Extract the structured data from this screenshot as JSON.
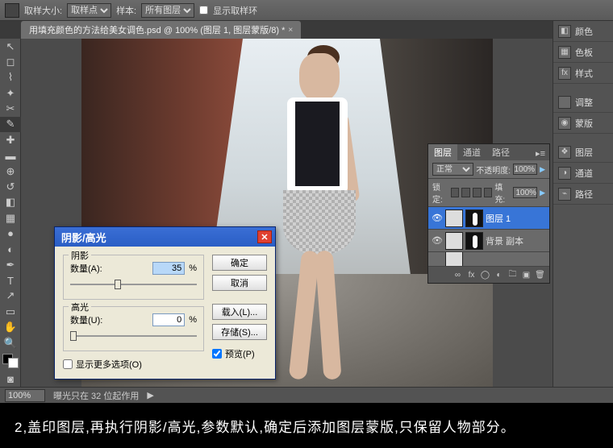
{
  "option_bar": {
    "sample_size_label": "取样大小:",
    "sample_size_value": "取样点",
    "sample_label": "样本:",
    "sample_value": "所有图层",
    "show_ring_label": "显示取样环"
  },
  "tab": {
    "title": "用填充颜色的方法给美女调色.psd @ 100% (图层 1, 图层蒙版/8) *"
  },
  "status": {
    "zoom": "100%",
    "info": "曝光只在 32 位起作用"
  },
  "rail": {
    "color": "颜色",
    "swatches": "色板",
    "styles": "样式",
    "adjustments": "调整",
    "masks": "蒙版",
    "layers": "图层",
    "channels": "通道",
    "paths": "路径"
  },
  "layers": {
    "tab_layers": "图层",
    "tab_channels": "通道",
    "tab_paths": "路径",
    "blend": "正常",
    "opacity_label": "不透明度:",
    "opacity": "100%",
    "lock_label": "锁定:",
    "fill_label": "填充:",
    "fill": "100%",
    "rows": [
      {
        "name": "图层 1"
      },
      {
        "name": "背景 副本"
      },
      {
        "name": ""
      }
    ]
  },
  "dialog": {
    "title": "阴影/高光",
    "shadow_group": "阴影",
    "shadow_amount_label": "数量(A):",
    "shadow_amount": "35",
    "highlight_group": "高光",
    "highlight_amount_label": "数量(U):",
    "highlight_amount": "0",
    "pct": "%",
    "more_options": "显示更多选项(O)",
    "ok": "确定",
    "cancel": "取消",
    "load": "载入(L)...",
    "save": "存储(S)...",
    "preview": "预览(P)"
  },
  "caption": "2,盖印图层,再执行阴影/高光,参数默认,确定后添加图层蒙版,只保留人物部分。"
}
